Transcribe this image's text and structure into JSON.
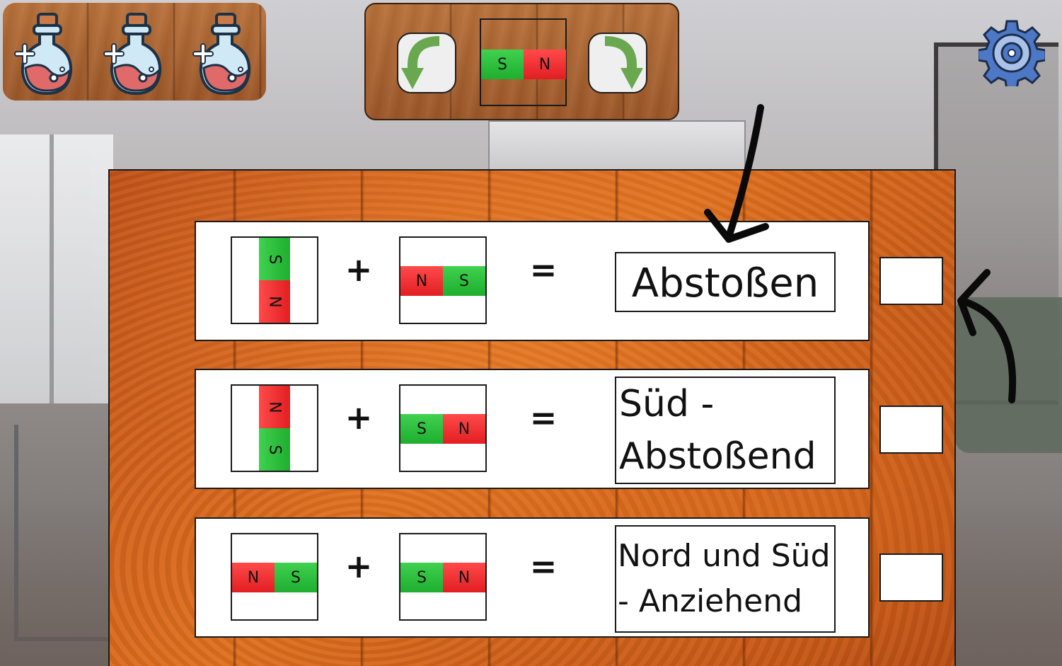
{
  "potions": [
    {
      "name": "potion-1",
      "icon": "potion-plus-icon"
    },
    {
      "name": "potion-2",
      "icon": "potion-plus-icon"
    },
    {
      "name": "potion-3",
      "icon": "potion-plus-icon"
    }
  ],
  "controls": {
    "rotate_left_icon": "rotate-left-icon",
    "rotate_right_icon": "rotate-right-icon",
    "current_magnet": {
      "left": "S",
      "right": "N"
    }
  },
  "settings_icon": "gear-icon",
  "rows": [
    {
      "magnet_a": {
        "orientation": "vertical",
        "top": "S",
        "bottom": "N"
      },
      "plus": "+",
      "magnet_b": {
        "orientation": "horizontal",
        "left": "N",
        "right": "S"
      },
      "equals": "=",
      "answer": "Abstoßen"
    },
    {
      "magnet_a": {
        "orientation": "vertical",
        "top": "N",
        "bottom": "S"
      },
      "plus": "+",
      "magnet_b": {
        "orientation": "horizontal",
        "left": "S",
        "right": "N"
      },
      "equals": "=",
      "answer_line1": "Süd -",
      "answer_line2": "Abstoßend"
    },
    {
      "magnet_a": {
        "orientation": "horizontal",
        "left": "N",
        "right": "S"
      },
      "plus": "+",
      "magnet_b": {
        "orientation": "horizontal",
        "left": "S",
        "right": "N"
      },
      "equals": "=",
      "answer_line1": "Nord und Süd",
      "answer_line2": "- Anziehend"
    }
  ],
  "colors": {
    "north_pole": "#e21e22",
    "south_pole": "#1fae2f",
    "wood": "#e0701f"
  }
}
